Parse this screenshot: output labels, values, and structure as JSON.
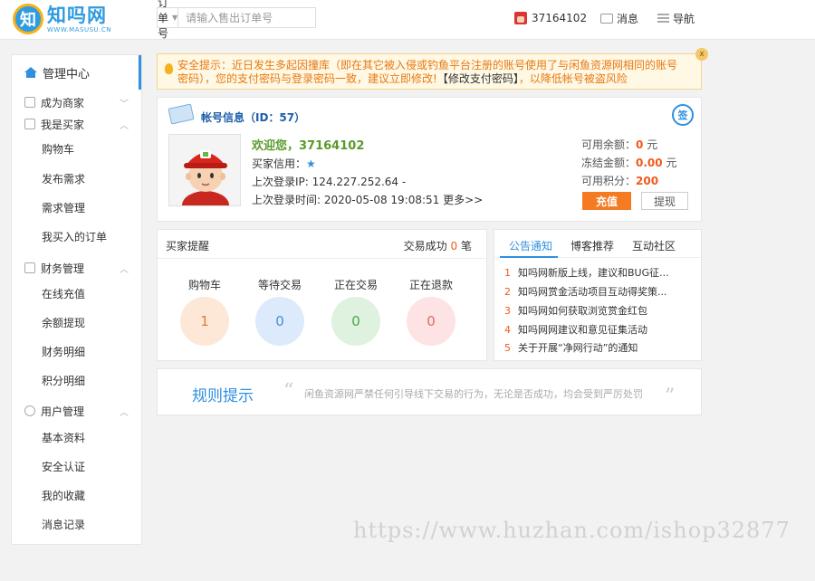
{
  "header": {
    "logo_mark": "知",
    "logo_name": "知吗网",
    "logo_sub": "WWW.MASUSU.CN",
    "search_type": "订单号",
    "search_placeholder": "请输入售出订单号",
    "username": "37164102",
    "messages_label": "消息",
    "nav_label": "导航"
  },
  "sidebar": {
    "home_label": "管理中心",
    "groups": [
      {
        "label": "成为商家",
        "chevron": "﹀",
        "items": []
      },
      {
        "label": "我是买家",
        "chevron": "︿",
        "items": [
          "购物车",
          "发布需求",
          "需求管理",
          "我买入的订单"
        ]
      },
      {
        "label": "财务管理",
        "chevron": "︿",
        "items": [
          "在线充值",
          "余额提现",
          "财务明细",
          "积分明细"
        ]
      },
      {
        "label": "用户管理",
        "chevron": "︿",
        "items": [
          "基本资料",
          "安全认证",
          "我的收藏",
          "消息记录"
        ]
      }
    ]
  },
  "alert": {
    "text": "安全提示：近日发生多起因撞库（即在其它被入侵或钓鱼平台注册的账号使用了与闲鱼资源网相同的账号密码），您的支付密码与登录密码一致，建议立即修改!",
    "link": "【修改支付密码】",
    "suffix": "，以降低帐号被盗风险",
    "close": "x"
  },
  "account": {
    "title": "帐号信息（ID：57）",
    "sign": "签",
    "welcome": "欢迎您，37164102",
    "credit_label": "买家信用：",
    "last_ip": "上次登录IP: 124.227.252.64 -",
    "last_time": "上次登录时间: 2020-05-08 19:08:51",
    "more": "更多>>",
    "available_label": "可用余额：",
    "available_value": "0",
    "frozen_label": "冻结金额：",
    "frozen_value": "0.00",
    "points_label": "可用积分：",
    "points_value": "200",
    "unit": "元",
    "recharge": "充值",
    "withdraw": "提现"
  },
  "remind": {
    "title": "买家提醒",
    "success_label": "交易成功",
    "success_count": "0",
    "success_unit": "笔",
    "stats": [
      {
        "label": "购物车",
        "value": "1",
        "bg": "#fde8d8",
        "fg": "#e67a3a"
      },
      {
        "label": "等待交易",
        "value": "0",
        "bg": "#dceafb",
        "fg": "#4a8fd6"
      },
      {
        "label": "正在交易",
        "value": "0",
        "bg": "#dff2df",
        "fg": "#4aa64a"
      },
      {
        "label": "正在退款",
        "value": "0",
        "bg": "#fde3e3",
        "fg": "#e06a6a"
      }
    ]
  },
  "notice": {
    "tabs": [
      "公告通知",
      "博客推荐",
      "互动社区"
    ],
    "items": [
      {
        "idx": "1",
        "text": "知吗网新版上线，建议和BUG征..."
      },
      {
        "idx": "2",
        "text": "知吗网赏金活动项目互动得奖策..."
      },
      {
        "idx": "3",
        "text": "知吗网如何获取浏览赏金红包"
      },
      {
        "idx": "4",
        "text": "知吗网网建议和意见征集活动"
      },
      {
        "idx": "5",
        "text": "关于开展“净网行动”的通知"
      }
    ]
  },
  "rules": {
    "title": "规则提示",
    "quote_open": "“",
    "quote_close": "”",
    "text": "闲鱼资源网严禁任何引导线下交易的行为，无论是否成功，均会受到严厉处罚"
  },
  "watermark": "https://www.huzhan.com/ishop32877"
}
